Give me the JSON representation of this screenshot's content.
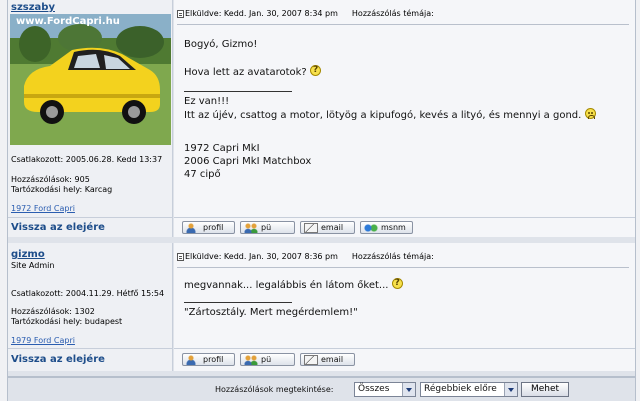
{
  "post1": {
    "username": "szszaby",
    "avatar": {
      "watermark": "www.FordCapri.hu"
    },
    "joined": "Csatlakozott: 2005.06.28. Kedd 13:37",
    "posts": "Hozzászólások: 905",
    "location": "Tartózkodási hely: Karcag",
    "car_link": "1972 Ford Capri",
    "back_to_top": "Vissza az elejére",
    "sent": "Elküldve: Kedd. Jan. 30, 2007 8:34 pm",
    "subject": "Hozzászólás témája:",
    "lines": {
      "l1": "Bogyó, Gizmo!",
      "l2": "Hova lett az avatarotok?",
      "l3": "Ez van!!!",
      "l4": "Itt az újév, csattog a motor, lötyög a kipufogó, kevés a lityó, és mennyi a gond.",
      "l5": "1972 Capri MkI",
      "l6": "2006 Capri MkI Matchbox",
      "l7": "47 cipő"
    },
    "buttons": {
      "profile": "profil",
      "pm": "pü",
      "email": "email",
      "msnm": "msnm"
    }
  },
  "post2": {
    "username": "gizmo",
    "rank": "Site Admin",
    "joined": "Csatlakozott: 2004.11.29. Hétfő 15:54",
    "posts": "Hozzászólások: 1302",
    "location": "Tartózkodási hely: budapest",
    "car_link": "1979 Ford Capri",
    "back_to_top": "Vissza az elejére",
    "sent": "Elküldve: Kedd. Jan. 30, 2007 8:36 pm",
    "subject": "Hozzászólás témája:",
    "lines": {
      "l1": "megvannak... legalábbis én látom őket...",
      "l2": "\"Zártosztály. Mert megérdemlem!\""
    },
    "buttons": {
      "profile": "profil",
      "pm": "pü",
      "email": "email"
    }
  },
  "footer": {
    "label": "Hozzászólások megtekintése:",
    "filter_selected": "Összes",
    "order_selected": "Régebbiek előre",
    "go_button": "Mehet"
  }
}
